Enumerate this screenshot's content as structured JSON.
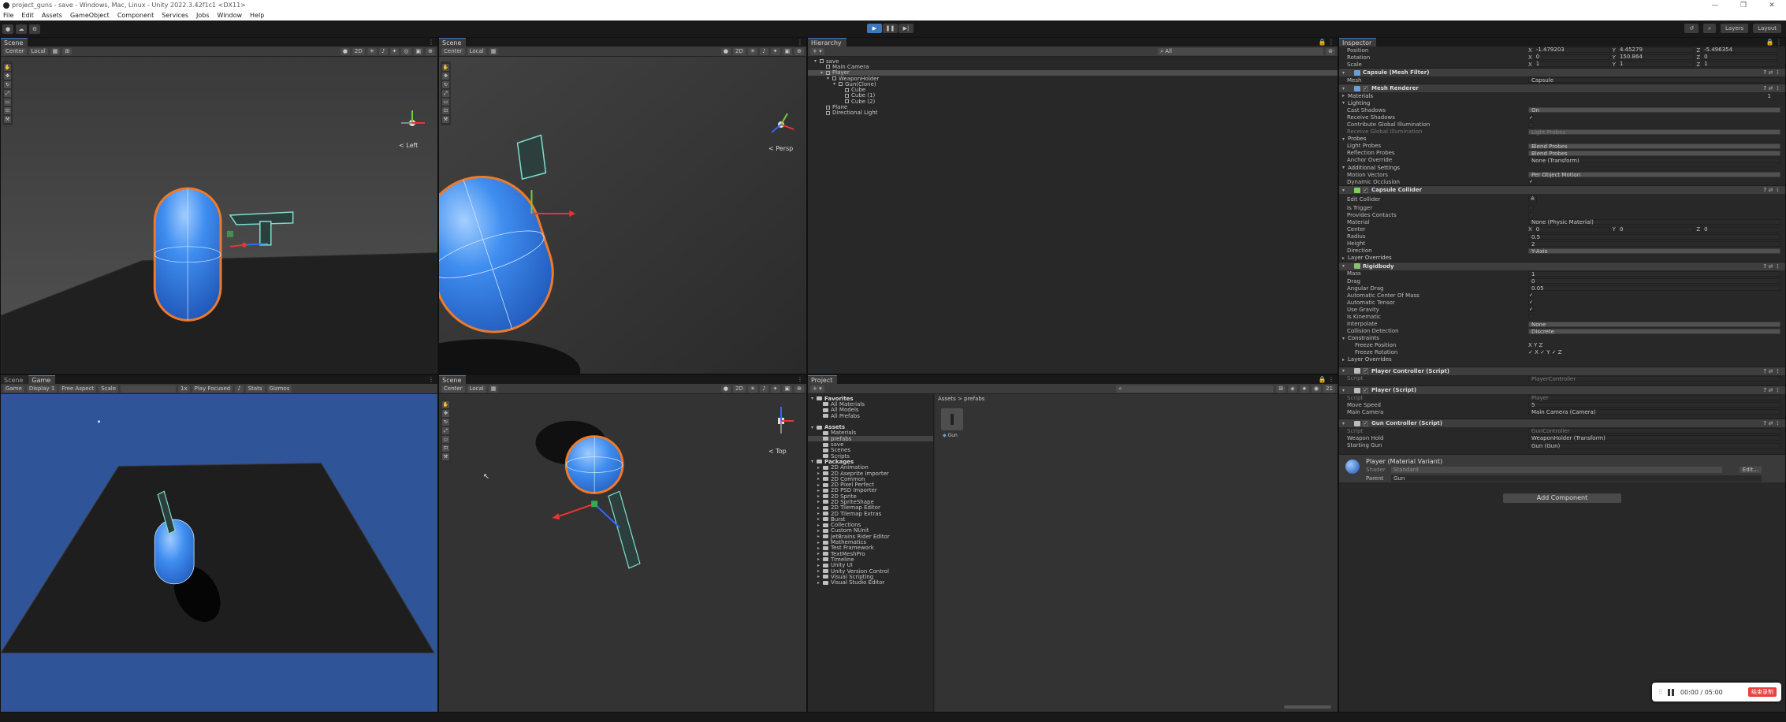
{
  "window": {
    "title": "project_guns - save - Windows, Mac, Linux - Unity 2022.3.42f1c1 <DX11>",
    "controls": [
      "—",
      "❐",
      "✕"
    ]
  },
  "menu": [
    "File",
    "Edit",
    "Assets",
    "GameObject",
    "Component",
    "Services",
    "Jobs",
    "Window",
    "Help"
  ],
  "toolbar": {
    "play": "▶",
    "pause": "❚❚",
    "step": "▶|",
    "layers": "Layers",
    "layout": "Layout"
  },
  "scene_tl": {
    "tab": "Scene",
    "pivot": "Center",
    "space": "Local",
    "mode_2d": "2D",
    "view_label": "< Left"
  },
  "scene_tr": {
    "tab": "Scene",
    "pivot": "Center",
    "space": "Local",
    "mode_2d": "2D",
    "view_label": "< Persp"
  },
  "game_view": {
    "tab_scene": "Scene",
    "tab_game": "Game",
    "mode": "Game",
    "display": "Display 1",
    "aspect": "Free Aspect",
    "scale_label": "Scale",
    "scale_value": "1x",
    "play_focused": "Play Focused",
    "stats": "Stats",
    "gizmos": "Gizmos"
  },
  "scene_br": {
    "tab": "Scene",
    "pivot": "Center",
    "space": "Local",
    "mode_2d": "2D",
    "view_label": "< Top"
  },
  "hierarchy": {
    "tab": "Hierarchy",
    "search_placeholder": "All",
    "items": [
      {
        "label": "save",
        "indent": 0,
        "icon": "unity",
        "tri": "▾"
      },
      {
        "label": "Main Camera",
        "indent": 1,
        "icon": "cube",
        "tri": ""
      },
      {
        "label": "Player",
        "indent": 1,
        "icon": "cube",
        "tri": "▾",
        "selected": true
      },
      {
        "label": "WeaponHolder",
        "indent": 2,
        "icon": "cube",
        "tri": "▾"
      },
      {
        "label": "Gun(Clone)",
        "indent": 3,
        "icon": "cube",
        "tri": "▾"
      },
      {
        "label": "Cube",
        "indent": 4,
        "icon": "cube",
        "tri": ""
      },
      {
        "label": "Cube (1)",
        "indent": 4,
        "icon": "cube",
        "tri": ""
      },
      {
        "label": "Cube (2)",
        "indent": 4,
        "icon": "cube",
        "tri": ""
      },
      {
        "label": "Plane",
        "indent": 1,
        "icon": "cube",
        "tri": ""
      },
      {
        "label": "Directional Light",
        "indent": 1,
        "icon": "cube",
        "tri": ""
      }
    ]
  },
  "project": {
    "tab": "Project",
    "breadcrumb_root": "Assets",
    "breadcrumb_sep": ">",
    "breadcrumb_current": "prefabs",
    "hidden_count": "21",
    "tree": [
      {
        "label": "Favorites",
        "indent": 0,
        "header": true,
        "tri": "▾"
      },
      {
        "label": "All Materials",
        "indent": 1
      },
      {
        "label": "All Models",
        "indent": 1
      },
      {
        "label": "All Prefabs",
        "indent": 1
      },
      {
        "label": "",
        "indent": 0,
        "spacer": true
      },
      {
        "label": "Assets",
        "indent": 0,
        "header": true,
        "tri": "▾"
      },
      {
        "label": "Materials",
        "indent": 1
      },
      {
        "label": "prefabs",
        "indent": 1,
        "selected": true
      },
      {
        "label": "save",
        "indent": 1
      },
      {
        "label": "Scenes",
        "indent": 1
      },
      {
        "label": "Scripts",
        "indent": 1
      },
      {
        "label": "Packages",
        "indent": 0,
        "header": true,
        "tri": "▾"
      },
      {
        "label": "2D Animation",
        "indent": 1,
        "tri": "▸"
      },
      {
        "label": "2D Aseprite Importer",
        "indent": 1,
        "tri": "▸"
      },
      {
        "label": "2D Common",
        "indent": 1,
        "tri": "▸"
      },
      {
        "label": "2D Pixel Perfect",
        "indent": 1,
        "tri": "▸"
      },
      {
        "label": "2D PSD Importer",
        "indent": 1,
        "tri": "▸"
      },
      {
        "label": "2D Sprite",
        "indent": 1,
        "tri": "▸"
      },
      {
        "label": "2D SpriteShape",
        "indent": 1,
        "tri": "▸"
      },
      {
        "label": "2D Tilemap Editor",
        "indent": 1,
        "tri": "▸"
      },
      {
        "label": "2D Tilemap Extras",
        "indent": 1,
        "tri": "▸"
      },
      {
        "label": "Burst",
        "indent": 1,
        "tri": "▸"
      },
      {
        "label": "Collections",
        "indent": 1,
        "tri": "▸"
      },
      {
        "label": "Custom NUnit",
        "indent": 1,
        "tri": "▸"
      },
      {
        "label": "JetBrains Rider Editor",
        "indent": 1,
        "tri": "▸"
      },
      {
        "label": "Mathematics",
        "indent": 1,
        "tri": "▸"
      },
      {
        "label": "Test Framework",
        "indent": 1,
        "tri": "▸"
      },
      {
        "label": "TextMeshPro",
        "indent": 1,
        "tri": "▸"
      },
      {
        "label": "Timeline",
        "indent": 1,
        "tri": "▸"
      },
      {
        "label": "Unity UI",
        "indent": 1,
        "tri": "▸"
      },
      {
        "label": "Unity Version Control",
        "indent": 1,
        "tri": "▸"
      },
      {
        "label": "Visual Scripting",
        "indent": 1,
        "tri": "▸"
      },
      {
        "label": "Visual Studio Editor",
        "indent": 1,
        "tri": "▸"
      }
    ],
    "asset": "Gun"
  },
  "inspector": {
    "tab": "Inspector",
    "transform": {
      "position_label": "Position",
      "pos_x": "-1.479203",
      "pos_y": "4.45279",
      "pos_z": "-5.496354",
      "rotation_label": "Rotation",
      "rot_x": "0",
      "rot_y": "150.864",
      "rot_z": "0",
      "scale_label": "Scale",
      "scl_x": "1",
      "scl_y": "1",
      "scl_z": "1"
    },
    "mesh_filter": {
      "title": "Capsule (Mesh Filter)",
      "mesh_label": "Mesh",
      "mesh_value": "Capsule"
    },
    "mesh_renderer": {
      "title": "Mesh Renderer",
      "materials_label": "Materials",
      "materials_count": "1",
      "lighting": "Lighting",
      "cast_shadows_label": "Cast Shadows",
      "cast_shadows": "On",
      "receive_shadows_label": "Receive Shadows",
      "contribute_gi_label": "Contribute Global Illumination",
      "receive_gi_label": "Receive Global Illumination",
      "receive_gi": "Light Probes",
      "probes": "Probes",
      "light_probes_label": "Light Probes",
      "light_probes": "Blend Probes",
      "reflection_probes_label": "Reflection Probes",
      "reflection_probes": "Blend Probes",
      "anchor_label": "Anchor Override",
      "anchor": "None (Transform)",
      "additional": "Additional Settings",
      "motion_label": "Motion Vectors",
      "motion": "Per Object Motion",
      "dynamic_occ_label": "Dynamic Occlusion"
    },
    "capsule_collider": {
      "title": "Capsule Collider",
      "edit_label": "Edit Collider",
      "trigger_label": "Is Trigger",
      "contacts_label": "Provides Contacts",
      "material_label": "Material",
      "material": "None (Physic Material)",
      "center_label": "Center",
      "cx": "0",
      "cy": "0",
      "cz": "0",
      "radius_label": "Radius",
      "radius": "0.5",
      "height_label": "Height",
      "height": "2",
      "direction_label": "Direction",
      "direction": "Y-Axis",
      "layer_overrides": "Layer Overrides"
    },
    "rigidbody": {
      "title": "Rigidbody",
      "mass_label": "Mass",
      "mass": "1",
      "drag_label": "Drag",
      "drag": "0",
      "angular_label": "Angular Drag",
      "angular": "0.05",
      "auto_com_label": "Automatic Center Of Mass",
      "auto_tensor_label": "Automatic Tensor",
      "gravity_label": "Use Gravity",
      "kinematic_label": "Is Kinematic",
      "interpolate_label": "Interpolate",
      "interpolate": "None",
      "collision_label": "Collision Detection",
      "collision": "Discrete",
      "constraints": "Constraints",
      "freeze_pos_label": "Freeze Position",
      "freeze_pos": "X  Y  Z",
      "freeze_rot_label": "Freeze Rotation",
      "freeze_rot": "✓ X ✓ Y ✓ Z",
      "layer_overrides": "Layer Overrides"
    },
    "player_controller": {
      "title": "Player Controller (Script)",
      "script_label": "Script",
      "script": "PlayerController"
    },
    "player_script": {
      "title": "Player (Script)",
      "script_label": "Script",
      "script": "Player",
      "speed_label": "Move Speed",
      "speed": "5",
      "camera_label": "Main Camera",
      "camera": "Main Camera (Camera)"
    },
    "gun_controller": {
      "title": "Gun Controller (Script)",
      "script_label": "Script",
      "script": "GunController",
      "hold_label": "Weapon Hold",
      "hold": "WeaponHolder (Transform)",
      "starting_label": "Starting Gun",
      "starting": "Gun (Gun)"
    },
    "material": {
      "title": "Player (Material Variant)",
      "shader_label": "Shader",
      "shader": "Standard",
      "edit": "Edit...",
      "parent_label": "Parent",
      "parent": "Gun"
    },
    "add_component": "Add Component"
  },
  "recorder": {
    "time": "00:00 / 05:00",
    "end_label": "结束录制"
  },
  "colors": {
    "accent": "#3a79bb",
    "capsule": "#3f8ef0",
    "outline": "#f07a28",
    "game_sky": "#2f5497"
  }
}
